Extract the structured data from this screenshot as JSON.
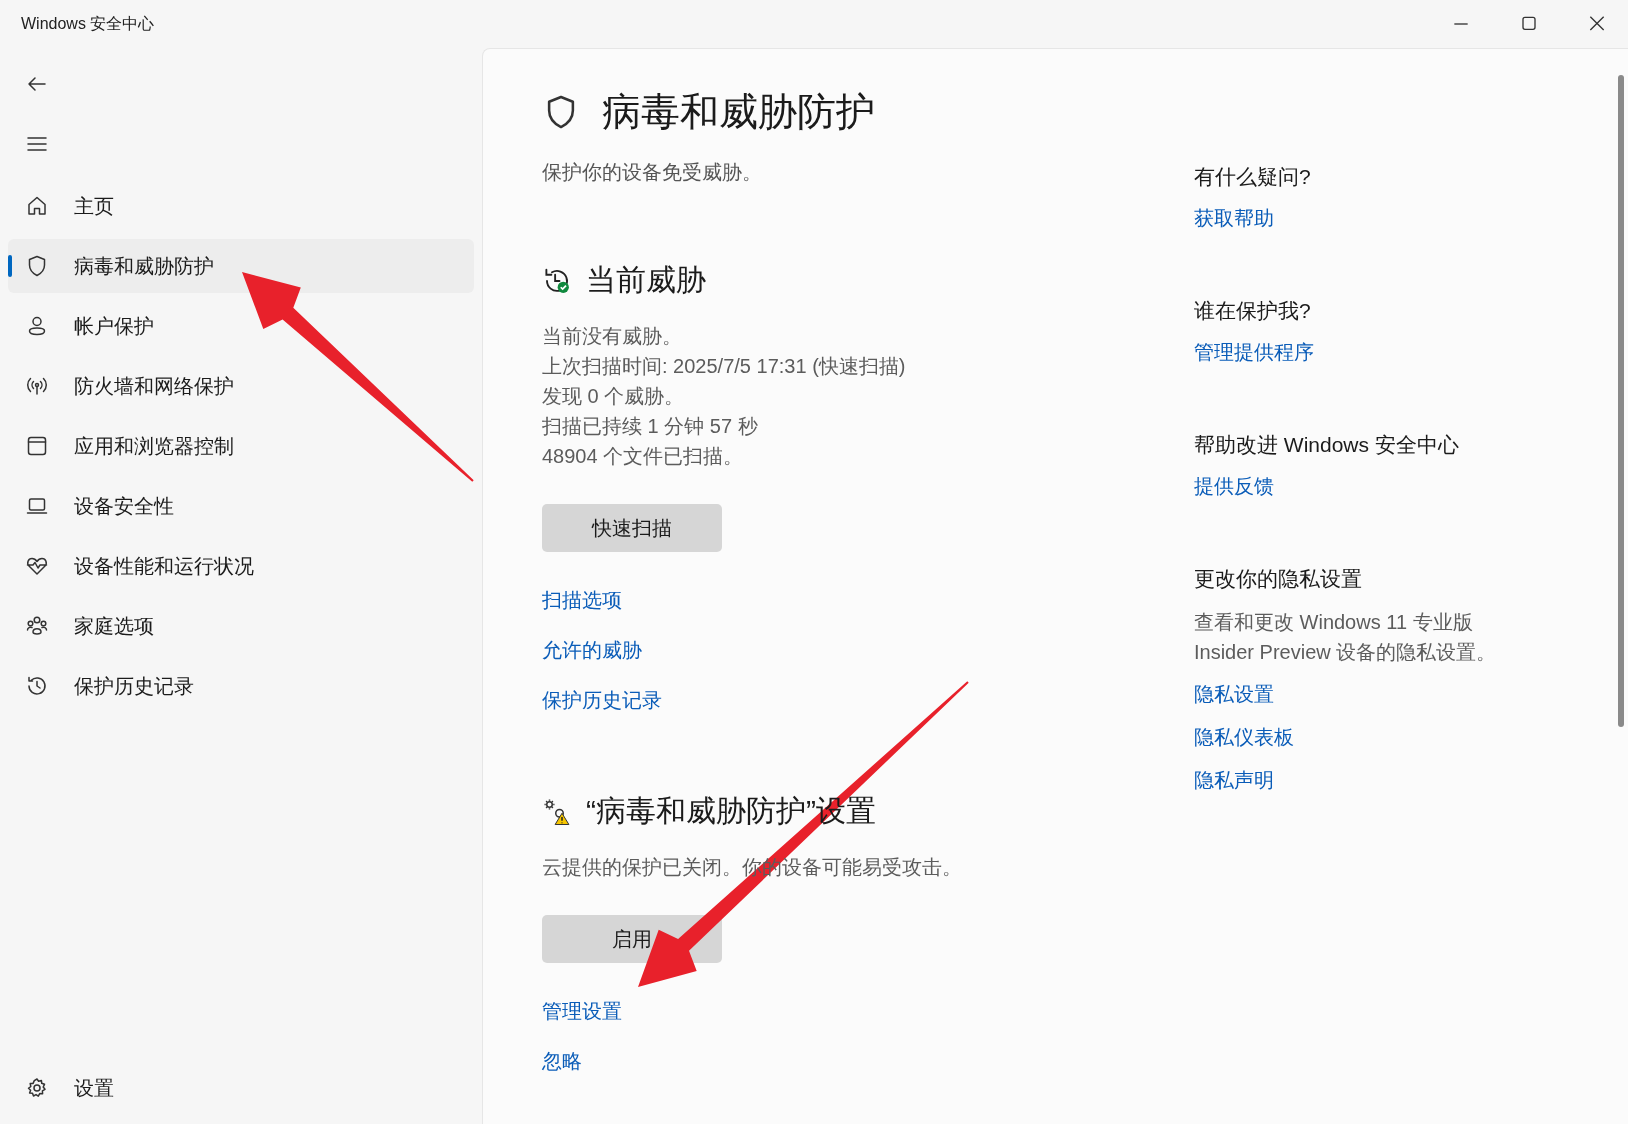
{
  "window": {
    "title": "Windows 安全中心"
  },
  "sidebar": {
    "items": [
      {
        "label": "主页",
        "selected": false
      },
      {
        "label": "病毒和威胁防护",
        "selected": true
      },
      {
        "label": "帐户保护",
        "selected": false
      },
      {
        "label": "防火墙和网络保护",
        "selected": false
      },
      {
        "label": "应用和浏览器控制",
        "selected": false
      },
      {
        "label": "设备安全性",
        "selected": false
      },
      {
        "label": "设备性能和运行状况",
        "selected": false
      },
      {
        "label": "家庭选项",
        "selected": false
      },
      {
        "label": "保护历史记录",
        "selected": false
      }
    ],
    "footer_item": {
      "label": "设置"
    }
  },
  "page": {
    "title": "病毒和威胁防护",
    "subtitle": "保护你的设备免受威胁。",
    "sections": [
      {
        "title": "当前威胁",
        "lines": [
          "当前没有威胁。",
          "上次扫描时间: 2025/7/5 17:31 (快速扫描)",
          "发现 0 个威胁。",
          "扫描已持续 1 分钟 57 秒",
          "48904 个文件已扫描。"
        ],
        "button": "快速扫描",
        "links": [
          "扫描选项",
          "允许的威胁",
          "保护历史记录"
        ]
      },
      {
        "title": "“病毒和威胁防护”设置",
        "lines": [
          "云提供的保护已关闭。你的设备可能易受攻击。"
        ],
        "button": "启用",
        "links": [
          "管理设置",
          "忽略"
        ]
      }
    ]
  },
  "aside": {
    "groups": [
      {
        "title": "有什么疑问?",
        "links": [
          "获取帮助"
        ]
      },
      {
        "title": "谁在保护我?",
        "links": [
          "管理提供程序"
        ]
      },
      {
        "title": "帮助改进 Windows 安全中心",
        "links": [
          "提供反馈"
        ]
      },
      {
        "title": "更改你的隐私设置",
        "text": "查看和更改 Windows 11 专业版 Insider Preview 设备的隐私设置。",
        "links": [
          "隐私设置",
          "隐私仪表板",
          "隐私声明"
        ]
      }
    ]
  }
}
